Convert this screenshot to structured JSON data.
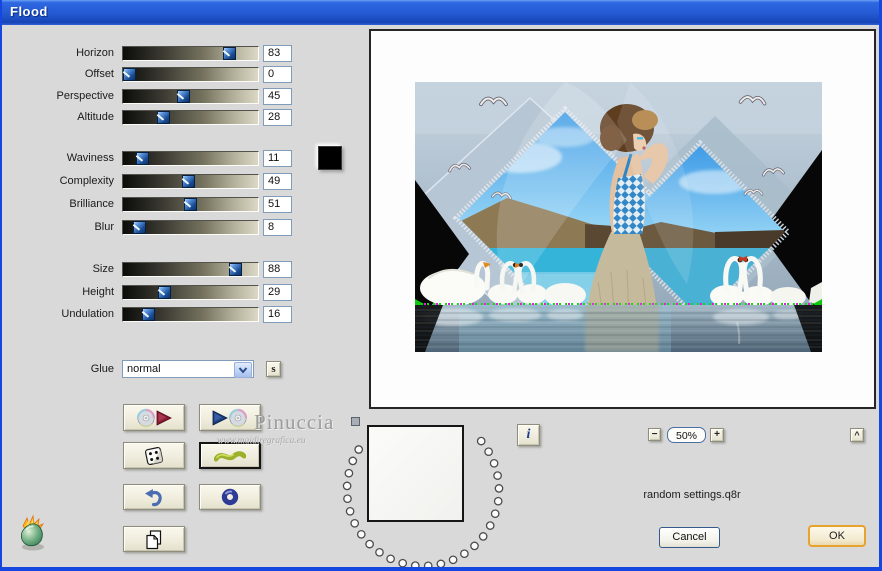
{
  "window": {
    "title": "Flood"
  },
  "sliders": [
    {
      "label": "Horizon",
      "value": 83
    },
    {
      "label": "Offset",
      "value": 0
    },
    {
      "label": "Perspective",
      "value": 45
    },
    {
      "label": "Altitude",
      "value": 28
    },
    {
      "label": "Waviness",
      "value": 11
    },
    {
      "label": "Complexity",
      "value": 49
    },
    {
      "label": "Brilliance",
      "value": 51
    },
    {
      "label": "Blur",
      "value": 8
    },
    {
      "label": "Size",
      "value": 88
    },
    {
      "label": "Height",
      "value": 29
    },
    {
      "label": "Undulation",
      "value": 16
    }
  ],
  "glue": {
    "label": "Glue",
    "selected": "normal",
    "sync_button": "s"
  },
  "color_swatch": {
    "color": "#000000"
  },
  "icons": {
    "open_settings": "cd-play-icon",
    "save_settings": "play-cd-icon",
    "randomize": "dice-icon",
    "wave": "wave-icon",
    "undo": "undo-arrow-icon",
    "ring": "ring-icon",
    "copy": "pages-icon",
    "info": "i",
    "dropdown": "chevron-down-icon",
    "logo": "flaming-pear-icon"
  },
  "zoom": {
    "out": "−",
    "level": "50%",
    "in": "+"
  },
  "caret_button": "^",
  "preset_name": "random settings.q8r",
  "actions": {
    "cancel": "Cancel",
    "ok": "OK"
  },
  "watermark": {
    "name": "Pinuccia",
    "site": "www.maidiregrafica.eu"
  }
}
